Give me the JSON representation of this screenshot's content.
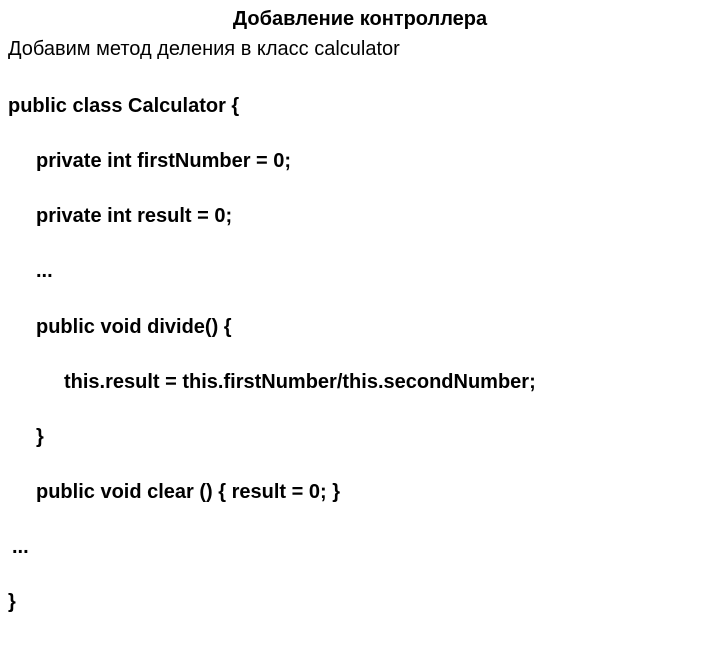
{
  "title": "Добавление контроллера",
  "intro": "Добавим метод деления в класс calculator",
  "code": {
    "l1": "public class Calculator {",
    "l2": "private int firstNumber = 0;",
    "l3": "private int result = 0;",
    "l4": "...",
    "l5": "public void divide() {",
    "l6": "this.result = this.firstNumber/this.secondNumber;",
    "l7": "}",
    "l8": "public void clear () { result = 0; }",
    "l9": "...",
    "l10": "}"
  }
}
